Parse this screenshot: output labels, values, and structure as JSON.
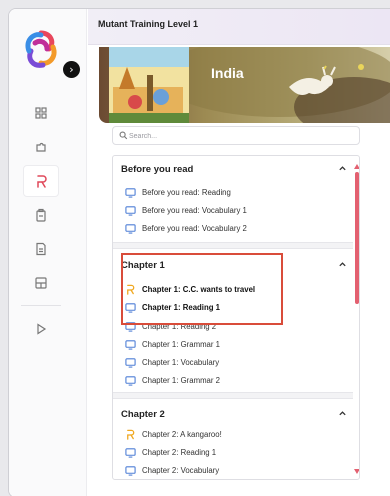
{
  "header": {
    "title": "Mutant Training Level 1"
  },
  "banner": {
    "title": "India"
  },
  "search": {
    "placeholder": "Search..."
  },
  "rail": {
    "items": [
      {
        "icon": "grid-icon"
      },
      {
        "icon": "puzzle-icon"
      },
      {
        "icon": "course-icon",
        "active": true
      },
      {
        "icon": "clipboard-icon"
      },
      {
        "icon": "document-icon"
      },
      {
        "icon": "dashboard-icon"
      },
      {
        "icon": "play-icon"
      }
    ]
  },
  "sections": [
    {
      "title": "Before you read",
      "lessons": [
        {
          "label": "Before you read: Reading",
          "icon": "monitor-icon"
        },
        {
          "label": "Before you read: Vocabulary 1",
          "icon": "monitor-icon"
        },
        {
          "label": "Before you read: Vocabulary 2",
          "icon": "monitor-icon"
        }
      ]
    },
    {
      "title": "Chapter 1",
      "lessons": [
        {
          "label": "Chapter 1: C.C. wants to travel",
          "icon": "story-icon",
          "bold": true
        },
        {
          "label": "Chapter 1: Reading 1",
          "icon": "monitor-icon",
          "bold": true
        },
        {
          "label": "Chapter 1: Reading 2",
          "icon": "monitor-icon"
        },
        {
          "label": "Chapter 1: Grammar 1",
          "icon": "monitor-icon"
        },
        {
          "label": "Chapter 1: Vocabulary",
          "icon": "monitor-icon"
        },
        {
          "label": "Chapter 1: Grammar 2",
          "icon": "monitor-icon"
        }
      ]
    },
    {
      "title": "Chapter 2",
      "lessons": [
        {
          "label": "Chapter 2: A kangaroo!",
          "icon": "story-icon"
        },
        {
          "label": "Chapter 2: Reading 1",
          "icon": "monitor-icon"
        },
        {
          "label": "Chapter 2: Vocabulary",
          "icon": "monitor-icon"
        }
      ]
    }
  ],
  "colors": {
    "accent": "#e36070",
    "highlight_box": "#d94c3a",
    "monitor_icon": "#4f7fd6",
    "story_icon": "#f0a820"
  }
}
